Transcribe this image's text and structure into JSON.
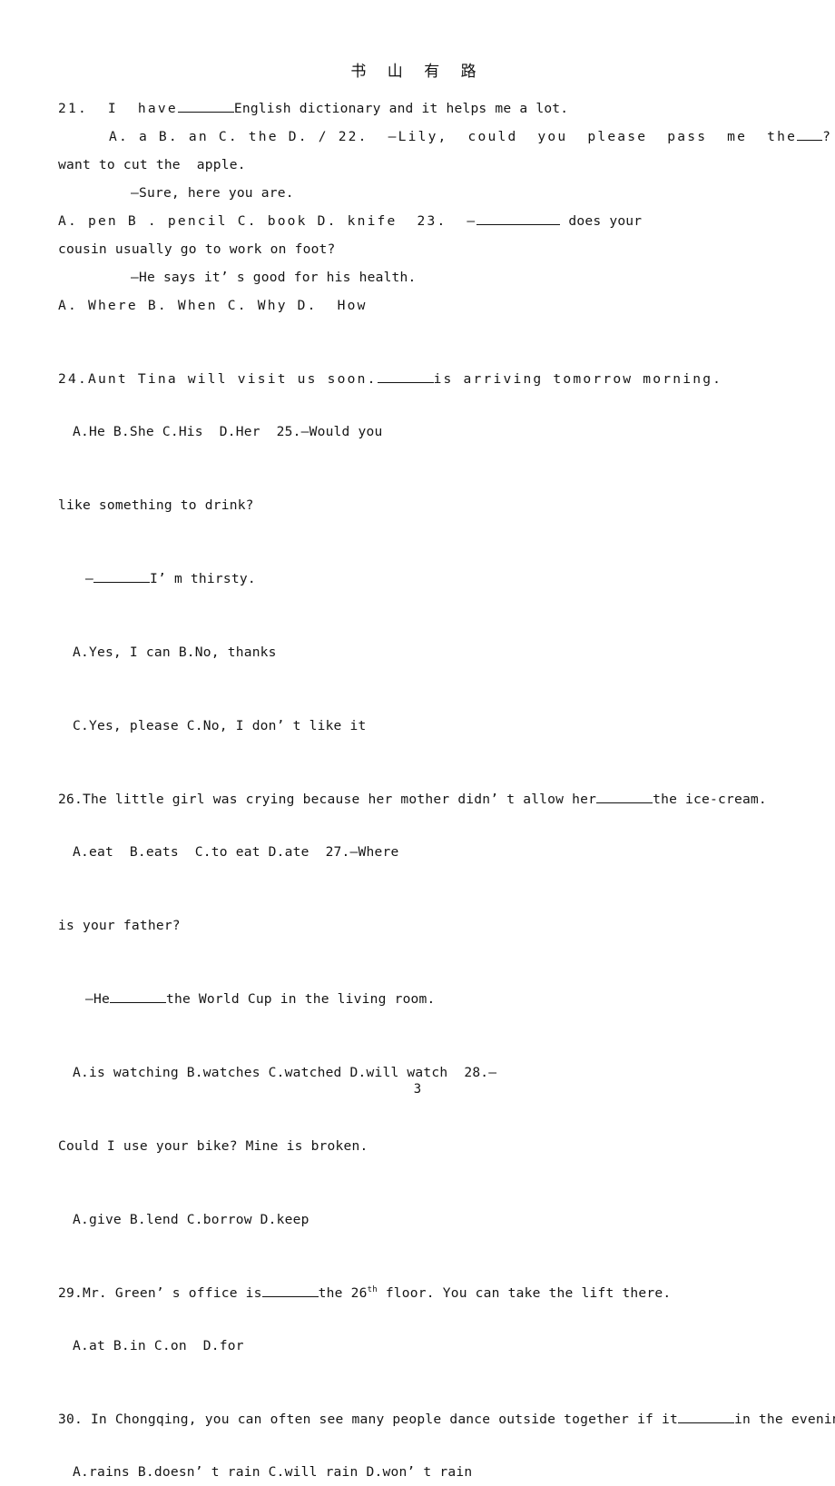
{
  "document": {
    "header_title": "书 山 有 路",
    "page_number": "3",
    "language": "English exam worksheet (Chinese school)",
    "text_color": "#151515"
  },
  "lines": {
    "l01": "21.  I  have",
    "l01b": "English dictionary and it helps me a lot.",
    "l02a": "A. a B. an C. the D. / ",
    "l02b": "22.  —Lily,  could  you  please  pass  me  the",
    "l02c": "? I",
    "l03": "want to cut the  apple.",
    "l04": "—Sure, here you are.",
    "l05a": "A. pen B . pencil C. book D. knife  23.  —",
    "l05b": " does your",
    "l06": "cousin usually go to work on foot?",
    "l07": "—He says it’ s good for his health.",
    "l08": "A. Where B. When C. Why D.  How",
    "l09a": "24.Aunt Tina will visit us soon.",
    "l09b": "is arriving tomorrow morning.",
    "l10": "A.He B.She C.His  D.Her  25.—Would you",
    "l11": "like something to drink?",
    "l12a": "—",
    "l12b": "I’ m thirsty.",
    "l13": "A.Yes, I can B.No, thanks",
    "l14": "C.Yes, please C.No, I don’ t like it",
    "l15a": "26.The little girl was crying because her mother didn’ t allow her",
    "l15b": "the ice-cream.",
    "l16": "A.eat  B.eats  C.to eat D.ate  27.—Where",
    "l17": "is your father?",
    "l18a": "—He",
    "l18b": "the World Cup in the living room.",
    "l19": "A.is watching B.watches C.watched D.will watch  28.—",
    "l20": "Could I use your bike? Mine is broken.",
    "l21": "A.give B.lend C.borrow D.keep",
    "l22a": "29.Mr. Green’ s office is",
    "l22b": "the 26",
    "l22sup": "th",
    "l22c": " floor. You can take the lift there.",
    "l23": "A.at B.in C.on  D.for",
    "l24a": "30. In Chongqing, you can often see many people dance outside together if it",
    "l24b": "in the evening.",
    "l25": "A.rains B.doesn’ t rain C.will rain D.won’ t rain"
  },
  "questions": [
    {
      "number": "21",
      "stem": "I have______English dictionary and it helps me a lot.",
      "options": [
        "A. a",
        "B. an",
        "C. the",
        "D. /"
      ]
    },
    {
      "number": "22",
      "stem": "—Lily, could you please pass me the__? I want to cut the apple. —Sure, here you are.",
      "options": [
        "A. pen",
        "B . pencil",
        "C. book",
        "D. knife"
      ]
    },
    {
      "number": "23",
      "stem": "—________ does your cousin usually go to work on foot? —He says it’s good for his health.",
      "options": [
        "A. Where",
        "B. When",
        "C. Why",
        "D. How"
      ]
    },
    {
      "number": "24",
      "stem": "Aunt Tina will visit us soon.______is arriving tomorrow morning.",
      "options": [
        "A.He",
        "B.She",
        "C.His",
        "D.Her"
      ]
    },
    {
      "number": "25",
      "stem": "—Would you like something to drink? —______I’m thirsty.",
      "options": [
        "A.Yes, I can",
        "B.No, thanks",
        "C.Yes, please",
        "C.No, I don’t like it"
      ]
    },
    {
      "number": "26",
      "stem": "The little girl was crying because her mother didn’t allow her______the ice-cream.",
      "options": [
        "A.eat",
        "B.eats",
        "C.to eat",
        "D.ate"
      ]
    },
    {
      "number": "27",
      "stem": "—Where is your father? —He______the World Cup in the living room.",
      "options": [
        "A.is watching",
        "B.watches",
        "C.watched",
        "D.will watch"
      ]
    },
    {
      "number": "28",
      "stem": "—Could I use your bike? Mine is broken.",
      "options": [
        "A.give",
        "B.lend",
        "C.borrow",
        "D.keep"
      ]
    },
    {
      "number": "29",
      "stem": "Mr. Green’s office is______the 26th floor. You can take the lift there.",
      "options": [
        "A.at",
        "B.in",
        "C.on",
        "D.for"
      ]
    },
    {
      "number": "30",
      "stem": "In Chongqing, you can often see many people dance outside together if it______in the evening.",
      "options": [
        "A.rains",
        "B.doesn’t rain",
        "C.will rain",
        "D.won’t rain"
      ]
    }
  ]
}
